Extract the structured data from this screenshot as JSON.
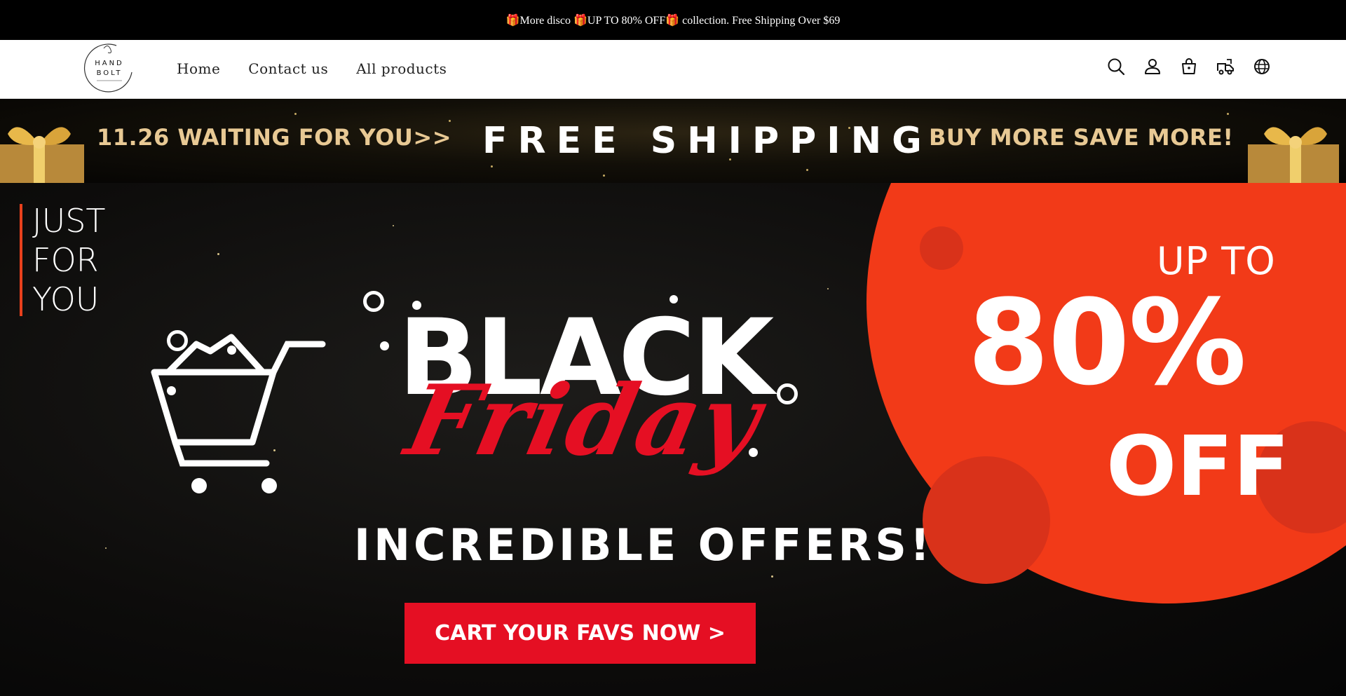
{
  "announcement": {
    "text": "🎁More disco 🎁UP TO 80% OFF🎁 collection. Free Shipping Over $69"
  },
  "header": {
    "logo_text": [
      "HAND",
      "BOLT"
    ],
    "nav": [
      {
        "label": "Home"
      },
      {
        "label": "Contact us"
      },
      {
        "label": "All products"
      }
    ],
    "icons": [
      "search-icon",
      "account-icon",
      "cart-icon",
      "order-tracking-icon",
      "language-icon"
    ]
  },
  "promo": {
    "left": "11.26 WAITING FOR YOU>>",
    "center": "FREE SHIPPING",
    "right": "BUY MORE SAVE MORE!"
  },
  "hero": {
    "just_for_you": [
      "JUST",
      "FOR",
      "YOU"
    ],
    "up_to": "UP TO",
    "percent": "80%",
    "off": "OFF",
    "black": "BLACK",
    "friday": "Friday",
    "tagline": "INCREDIBLE OFFERS!",
    "cta": "CART YOUR FAVS NOW >"
  },
  "colors": {
    "accent_red": "#e50f23",
    "circle_orange": "#f23a18",
    "gold": "#e8c994"
  }
}
